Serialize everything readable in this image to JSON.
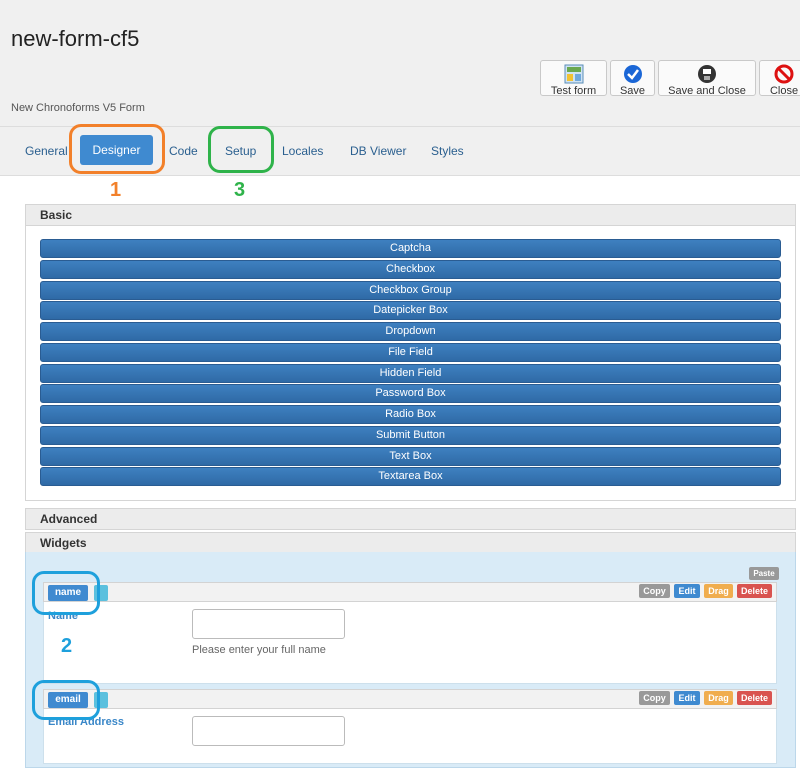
{
  "header": {
    "title": "new-form-cf5",
    "subtitle": "New Chronoforms V5 Form"
  },
  "toolbar": {
    "test_form": "Test form",
    "save": "Save",
    "save_and_close": "Save and Close",
    "close": "Close"
  },
  "tabs": [
    "General",
    "Designer",
    "Code",
    "Setup",
    "Locales",
    "DB Viewer",
    "Styles"
  ],
  "annotations": {
    "one": "1",
    "two": "2",
    "three": "3",
    "colors": {
      "one": "#f2802a",
      "two": "#1ea0dc",
      "three": "#2fb34a"
    }
  },
  "panels": {
    "basic": "Basic",
    "advanced": "Advanced",
    "widgets": "Widgets"
  },
  "basic_elements": [
    "Captcha",
    "Checkbox",
    "Checkbox Group",
    "Datepicker Box",
    "Dropdown",
    "File Field",
    "Hidden Field",
    "Password Box",
    "Radio Box",
    "Submit Button",
    "Text Box",
    "Textarea Box"
  ],
  "widgets": {
    "paste": "Paste",
    "actions": {
      "copy": "Copy",
      "edit": "Edit",
      "drag": "Drag",
      "delete": "Delete"
    },
    "fields": [
      {
        "tag": "name",
        "label": "Name",
        "help": "Please enter your full name"
      },
      {
        "tag": "email",
        "label": "Email Address"
      }
    ]
  }
}
